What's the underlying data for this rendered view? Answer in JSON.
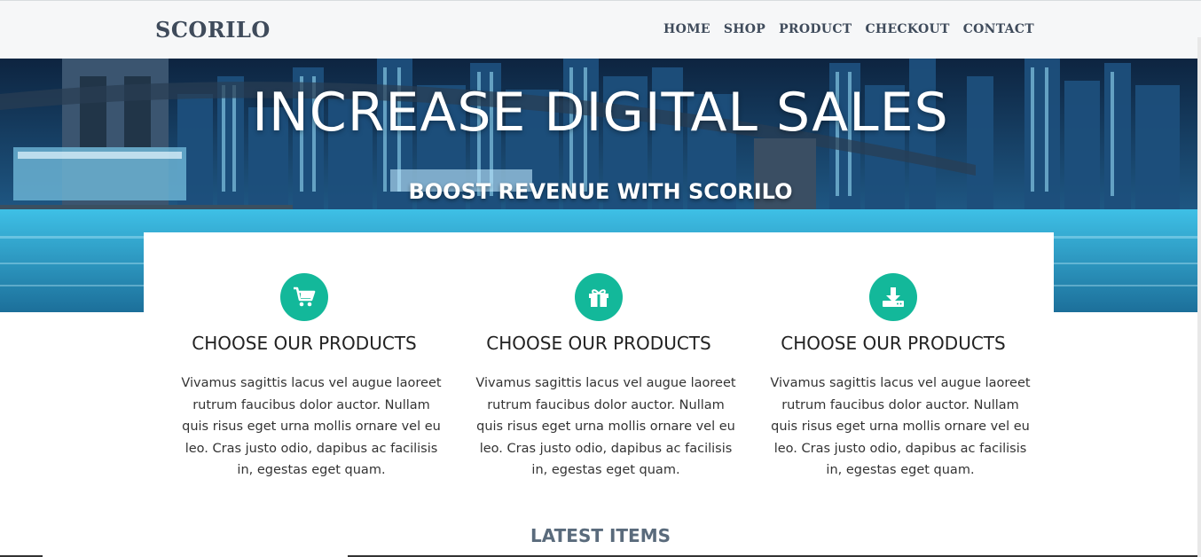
{
  "header": {
    "brand": "SCORILO",
    "nav": [
      "HOME",
      "SHOP",
      "PRODUCT",
      "CHECKOUT",
      "CONTACT"
    ]
  },
  "hero": {
    "title": "INCREASE DIGITAL SALES",
    "subtitle": "BOOST REVENUE WITH SCORILO"
  },
  "features": [
    {
      "icon": "cart-icon",
      "title": "CHOOSE OUR PRODUCTS",
      "text": "Vivamus sagittis lacus vel augue laoreet rutrum faucibus dolor auctor. Nullam quis risus eget urna mollis ornare vel eu leo. Cras justo odio, dapibus ac facilisis in, egestas eget quam."
    },
    {
      "icon": "gift-icon",
      "title": "CHOOSE OUR PRODUCTS",
      "text": "Vivamus sagittis lacus vel augue laoreet rutrum faucibus dolor auctor. Nullam quis risus eget urna mollis ornare vel eu leo. Cras justo odio, dapibus ac facilisis in, egestas eget quam."
    },
    {
      "icon": "download-icon",
      "title": "CHOOSE OUR PRODUCTS",
      "text": "Vivamus sagittis lacus vel augue laoreet rutrum faucibus dolor auctor. Nullam quis risus eget urna mollis ornare vel eu leo. Cras justo odio, dapibus ac facilisis in, egestas eget quam."
    }
  ],
  "latest": {
    "heading": "LATEST ITEMS"
  },
  "colors": {
    "accent": "#13b89a",
    "nav_text": "#3f4b5b"
  }
}
